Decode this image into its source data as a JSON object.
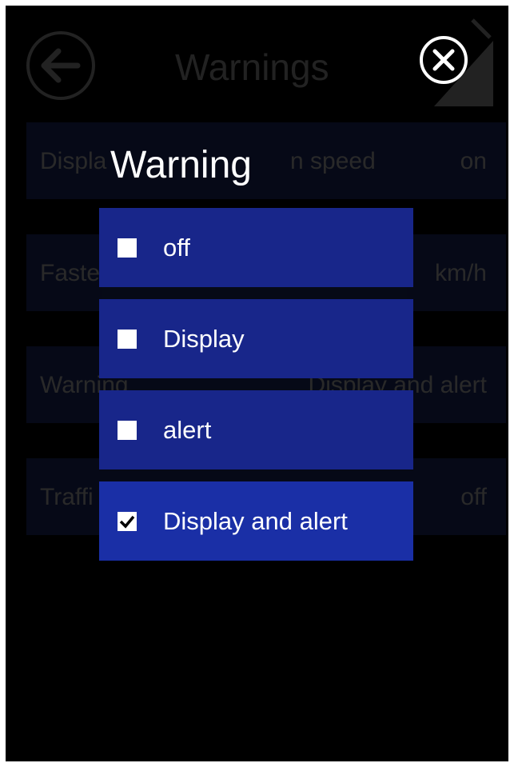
{
  "background": {
    "title": "Warnings",
    "rows": [
      {
        "label": "Displa",
        "label2": "n speed",
        "value": "on"
      },
      {
        "label": "Faste",
        "label2": "",
        "value": "km/h"
      },
      {
        "label": "Warning",
        "label2": "",
        "value": "Display and alert"
      },
      {
        "label": "Traffi",
        "label2": "",
        "value": "off"
      }
    ]
  },
  "dialog": {
    "title": "Warning",
    "options": [
      {
        "label": "off",
        "checked": false
      },
      {
        "label": "Display",
        "checked": false
      },
      {
        "label": "alert",
        "checked": false
      },
      {
        "label": "Display and alert",
        "checked": true
      }
    ]
  },
  "colors": {
    "option_bg": "#18268a",
    "selected_bg": "#1a2fa6",
    "background": "#000000"
  }
}
